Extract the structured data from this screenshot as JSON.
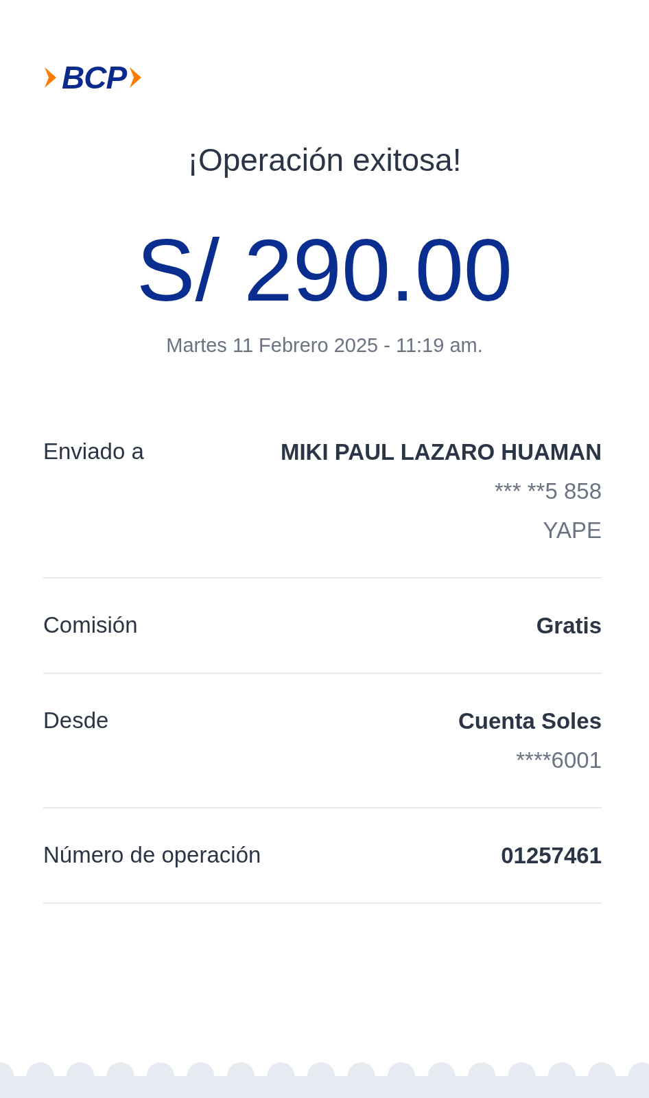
{
  "logo": {
    "text": "BCP"
  },
  "title": "¡Operación exitosa!",
  "amount": "S/ 290.00",
  "datetime": "Martes 11 Febrero 2025 - 11:19 am.",
  "details": [
    {
      "label": "Enviado a",
      "values": [
        {
          "text": "MIKI PAUL LAZARO HUAMAN",
          "kind": "primary"
        },
        {
          "text": "*** **5 858",
          "kind": "secondary"
        },
        {
          "text": "YAPE",
          "kind": "secondary"
        }
      ]
    },
    {
      "label": "Comisión",
      "values": [
        {
          "text": "Gratis",
          "kind": "primary"
        }
      ]
    },
    {
      "label": "Desde",
      "values": [
        {
          "text": "Cuenta Soles",
          "kind": "primary"
        },
        {
          "text": "****6001",
          "kind": "secondary"
        }
      ]
    },
    {
      "label": "Número de operación",
      "values": [
        {
          "text": "01257461",
          "kind": "primary"
        }
      ]
    }
  ]
}
